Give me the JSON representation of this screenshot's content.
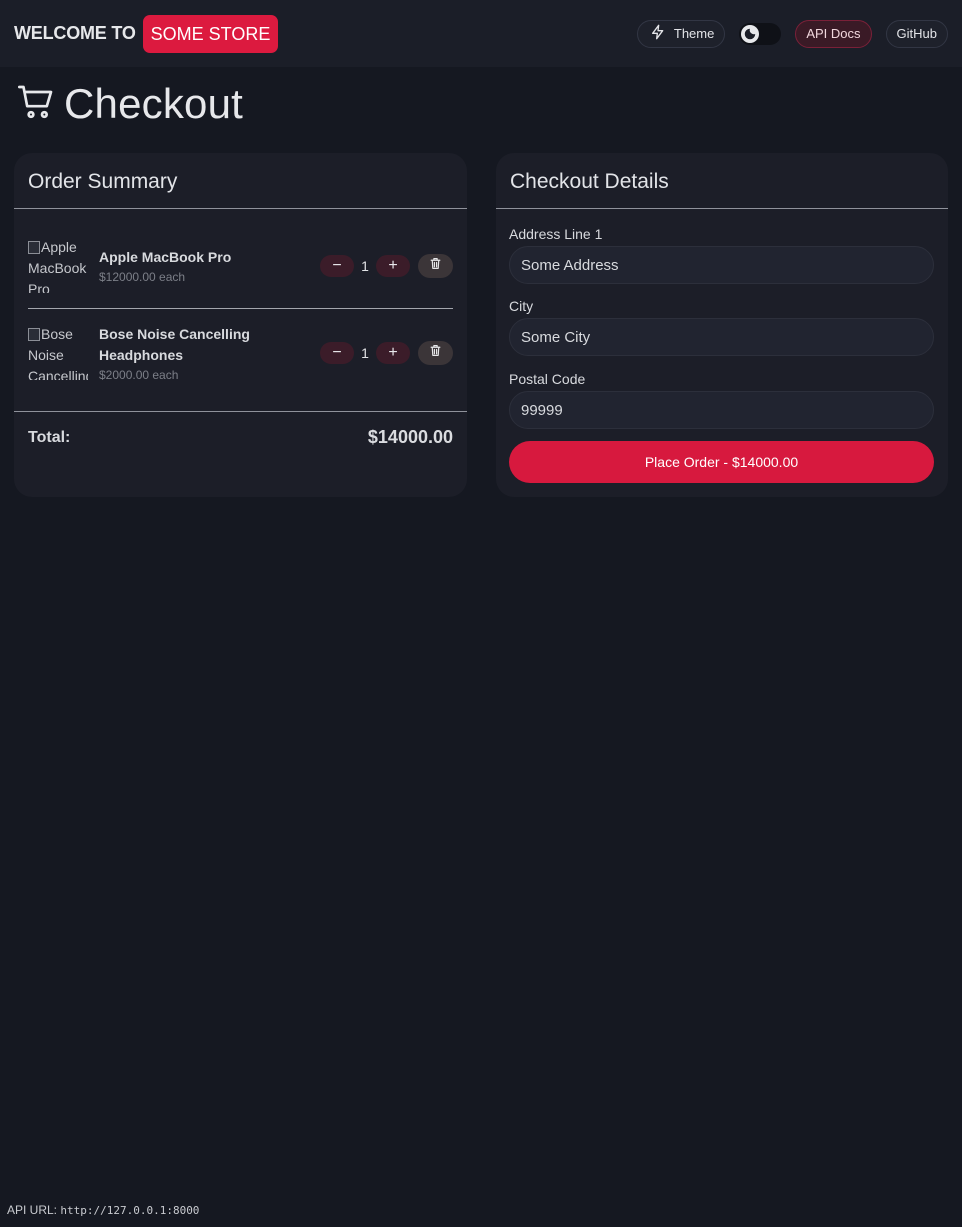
{
  "header": {
    "welcome": "WELCOME TO",
    "store": "SOME STORE",
    "theme_label": "Theme",
    "api_docs_label": "API Docs",
    "github_label": "GitHub"
  },
  "page": {
    "title": "Checkout"
  },
  "order_summary": {
    "title": "Order Summary",
    "items": [
      {
        "alt": "Apple MacBook Pro",
        "name": "Apple MacBook Pro",
        "price": "$12000.00 each",
        "qty": "1"
      },
      {
        "alt": "Bose Noise Cancelling Headphones",
        "name": "Bose Noise Cancelling Headphones",
        "price": "$2000.00 each",
        "qty": "1"
      }
    ],
    "total_label": "Total:",
    "total_value": "$14000.00"
  },
  "checkout_details": {
    "title": "Checkout Details",
    "address_label": "Address Line 1",
    "address_value": "Some Address",
    "city_label": "City",
    "city_value": "Some City",
    "postal_label": "Postal Code",
    "postal_value": "99999",
    "place_order_label": "Place Order - $14000.00"
  },
  "footer": {
    "label": "API URL:",
    "url": "http://127.0.0.1:8000"
  },
  "colors": {
    "accent": "#dc1a3f",
    "background": "#151821",
    "card": "#1c1e28"
  }
}
